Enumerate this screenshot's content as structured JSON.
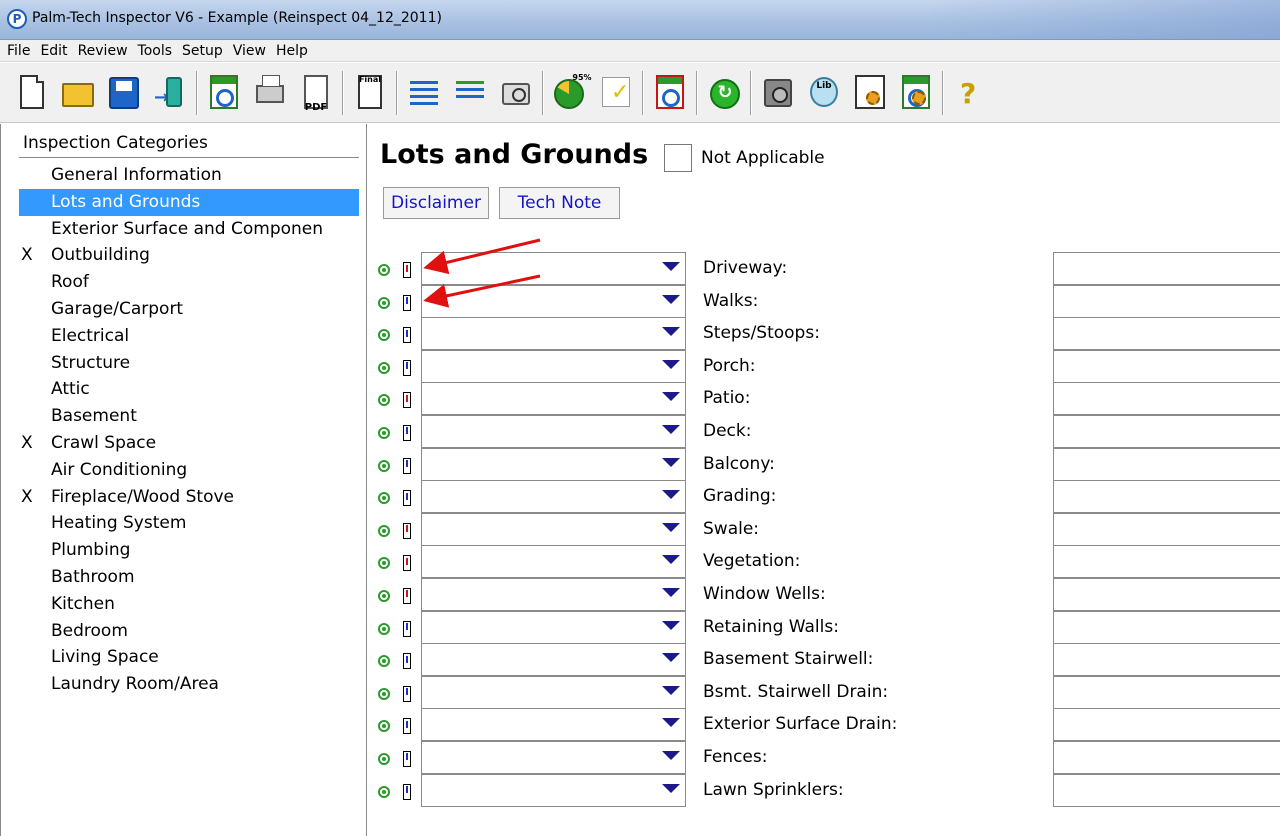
{
  "window": {
    "title": "Palm-Tech Inspector V6 - Example (Reinspect 04_12_2011)",
    "app_icon": "P"
  },
  "menu": [
    "File",
    "Edit",
    "Review",
    "Tools",
    "Setup",
    "View",
    "Help"
  ],
  "toolbar": {
    "buttons": [
      {
        "name": "new-document-icon"
      },
      {
        "name": "open-folder-icon"
      },
      {
        "name": "save-icon"
      },
      {
        "name": "transfer-to-device-icon"
      },
      {
        "name": "report-preview-icon",
        "badge": "report"
      },
      {
        "name": "print-icon"
      },
      {
        "name": "email-pdf-icon",
        "badge": "PDF"
      },
      {
        "name": "final-report-icon",
        "badge": "Final"
      },
      {
        "name": "narrative-list-icon"
      },
      {
        "name": "narrative-edit-icon"
      },
      {
        "name": "camera-icon"
      },
      {
        "name": "progress-pie-icon",
        "badge": "95%"
      },
      {
        "name": "checklist-icon"
      },
      {
        "name": "summary-report-icon",
        "badge": "summary"
      },
      {
        "name": "refresh-sync-icon"
      },
      {
        "name": "safe-backup-icon"
      },
      {
        "name": "library-icon",
        "badge": "Lib"
      },
      {
        "name": "program-settings-icon",
        "badge": "program"
      },
      {
        "name": "report-settings-icon",
        "badge": "report"
      },
      {
        "name": "help-question-icon"
      }
    ]
  },
  "sidebar": {
    "header": "Inspection Categories",
    "items": [
      {
        "label": "General Information",
        "marker": ""
      },
      {
        "label": "Lots and Grounds",
        "marker": "",
        "selected": true
      },
      {
        "label": "Exterior Surface and Componen",
        "marker": ""
      },
      {
        "label": "Outbuilding",
        "marker": "X"
      },
      {
        "label": "Roof",
        "marker": ""
      },
      {
        "label": "Garage/Carport",
        "marker": ""
      },
      {
        "label": "Electrical",
        "marker": ""
      },
      {
        "label": "Structure",
        "marker": ""
      },
      {
        "label": "Attic",
        "marker": ""
      },
      {
        "label": "Basement",
        "marker": ""
      },
      {
        "label": "Crawl Space",
        "marker": "X"
      },
      {
        "label": "Air Conditioning",
        "marker": ""
      },
      {
        "label": "Fireplace/Wood Stove",
        "marker": "X"
      },
      {
        "label": "Heating System",
        "marker": ""
      },
      {
        "label": "Plumbing",
        "marker": ""
      },
      {
        "label": "Bathroom",
        "marker": ""
      },
      {
        "label": "Kitchen",
        "marker": ""
      },
      {
        "label": "Bedroom",
        "marker": ""
      },
      {
        "label": "Living Space",
        "marker": ""
      },
      {
        "label": "Laundry Room/Area",
        "marker": ""
      }
    ]
  },
  "main": {
    "title": "Lots and Grounds",
    "not_applicable_label": "Not Applicable",
    "not_applicable_checked": false,
    "buttons": {
      "disclaimer": "Disclaimer",
      "tech_note": "Tech Note"
    },
    "rows": [
      {
        "label": "Driveway:",
        "flag": "red",
        "value": ""
      },
      {
        "label": "Walks:",
        "flag": "blue",
        "value": ""
      },
      {
        "label": "Steps/Stoops:",
        "flag": "blue",
        "value": ""
      },
      {
        "label": "Porch:",
        "flag": "blue",
        "value": ""
      },
      {
        "label": "Patio:",
        "flag": "red",
        "value": ""
      },
      {
        "label": "Deck:",
        "flag": "blue",
        "value": ""
      },
      {
        "label": "Balcony:",
        "flag": "blue",
        "value": ""
      },
      {
        "label": "Grading:",
        "flag": "blue",
        "value": ""
      },
      {
        "label": "Swale:",
        "flag": "red",
        "value": ""
      },
      {
        "label": "Vegetation:",
        "flag": "red",
        "value": ""
      },
      {
        "label": "Window Wells:",
        "flag": "red",
        "value": ""
      },
      {
        "label": "Retaining Walls:",
        "flag": "blue",
        "value": ""
      },
      {
        "label": "Basement Stairwell:",
        "flag": "blue",
        "value": ""
      },
      {
        "label": "Bsmt. Stairwell Drain:",
        "flag": "blue",
        "value": ""
      },
      {
        "label": "Exterior Surface Drain:",
        "flag": "blue",
        "value": ""
      },
      {
        "label": "Fences:",
        "flag": "blue",
        "value": ""
      },
      {
        "label": "Lawn Sprinklers:",
        "flag": "blue",
        "value": ""
      }
    ]
  },
  "colors": {
    "selection": "#3399ff",
    "link_text": "#1414c8",
    "flag_red": "#d21414",
    "flag_blue": "#1a2ec8",
    "annotation_arrow": "#e01010"
  }
}
